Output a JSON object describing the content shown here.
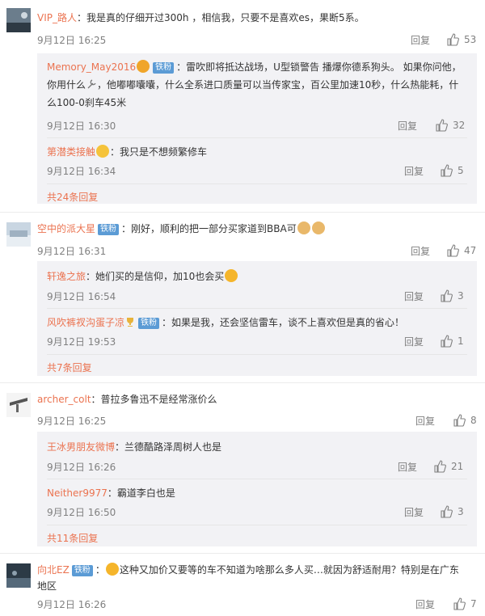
{
  "reply_label": "回复",
  "comments": [
    {
      "user": "VIP_路人",
      "text": "：我是真的仔细开过300h ，相信我，只要不是喜欢es，果断5系。",
      "time": "9月12日 16:25",
      "likes": "53",
      "replies": [
        {
          "user": "Memory_May2016",
          "badge": "铁粉",
          "text": "：雷吹即将抵达战场，U型锁警告 播爆你德系狗头。 如果你问他，你用什么",
          "text2": "，他嘟嘟囔囔，什么全系进口质量可以当传家宝，百公里加速10秒，什么热能耗，什么100-0刹车45米",
          "time": "9月12日 16:30",
          "likes": "32"
        },
        {
          "user": "第潜类接触",
          "text": "：我只是不想频繁修车",
          "time": "9月12日 16:34",
          "likes": "5"
        }
      ],
      "more": "共24条回复"
    },
    {
      "user": "空中的派大星",
      "badge": "铁粉",
      "text": "：刚好，顺利的把一部分买家道到BBA可",
      "time": "9月12日 16:31",
      "likes": "47",
      "replies": [
        {
          "user": "轩逸之旅",
          "text": "：她们买的是信仰，加10也会买",
          "time": "9月12日 16:54",
          "likes": "3"
        },
        {
          "user": "风吹裤衩沟蛋子凉",
          "badge": "铁粉",
          "text": "：如果是我，还会坚信雷车，谈不上喜欢但是真的省心！",
          "time": "9月12日 19:53",
          "likes": "1"
        }
      ],
      "more": "共7条回复"
    },
    {
      "user": "archer_colt",
      "text": "：普拉多鲁迅不是经常涨价么",
      "time": "9月12日 16:25",
      "likes": "8",
      "replies": [
        {
          "user": "王冰男朋友微博",
          "text": "：兰德酷路泽周树人也是",
          "time": "9月12日 16:26",
          "likes": "21"
        },
        {
          "user": "Neither9977",
          "text": "：霸道李白也是",
          "time": "9月12日 16:50",
          "likes": "3"
        }
      ],
      "more": "共11条回复"
    },
    {
      "user": "向北EZ",
      "badge": "铁粉",
      "text": "这种又加价又要等的车不知道为啥那么多人买…就因为舒适耐用？特别是在广东",
      "text2": "地区",
      "time": "9月12日 16:26",
      "likes": "7"
    }
  ],
  "icons": {
    "like": "thumbs-up-icon",
    "wrench": "wrench-icon",
    "trophy": "trophy-icon"
  },
  "colors": {
    "username": "#eb7350",
    "badge": "#5b9bd5",
    "reply_bg": "#f2f2f5"
  }
}
